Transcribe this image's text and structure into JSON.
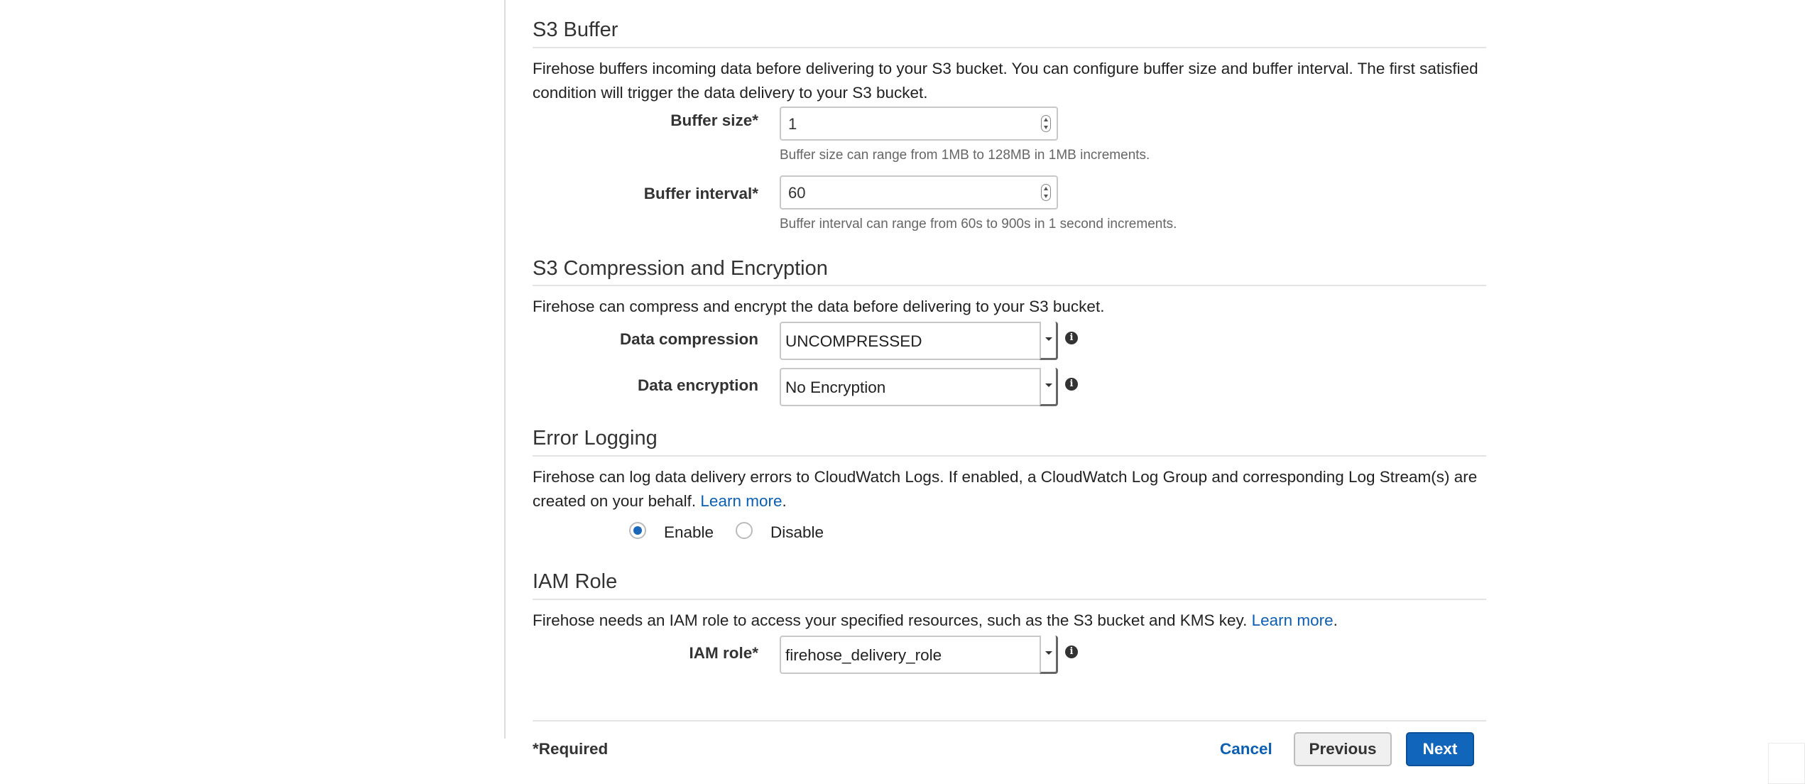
{
  "s3_buffer": {
    "title": "S3 Buffer",
    "description": "Firehose buffers incoming data before delivering to your S3 bucket. You can configure buffer size and buffer interval. The first satisfied condition will trigger the data delivery to your S3 bucket.",
    "buffer_size_label": "Buffer size*",
    "buffer_size_value": "1",
    "buffer_size_help": "Buffer size can range from 1MB to 128MB in 1MB increments.",
    "buffer_interval_label": "Buffer interval*",
    "buffer_interval_value": "60",
    "buffer_interval_help": "Buffer interval can range from 60s to 900s in 1 second increments."
  },
  "compression": {
    "title": "S3 Compression and Encryption",
    "description": "Firehose can compress and encrypt the data before delivering to your S3 bucket.",
    "compression_label": "Data compression",
    "compression_value": "UNCOMPRESSED",
    "encryption_label": "Data encryption",
    "encryption_value": "No Encryption"
  },
  "error_logging": {
    "title": "Error Logging",
    "description": "Firehose can log data delivery errors to CloudWatch Logs. If enabled, a CloudWatch Log Group and corresponding Log Stream(s) are created on your behalf.",
    "learn_more": "Learn more",
    "enable_label": "Enable",
    "disable_label": "Disable",
    "selected": "Enable"
  },
  "iam": {
    "title": "IAM Role",
    "description": "Firehose needs an IAM role to access your specified resources, such as the S3 bucket and KMS key.",
    "learn_more": "Learn more",
    "role_label": "IAM role*",
    "role_value": "firehose_delivery_role"
  },
  "footer": {
    "required_note": "*Required",
    "cancel_label": "Cancel",
    "previous_label": "Previous",
    "next_label": "Next"
  },
  "colors": {
    "link": "#0b5fb3",
    "primary_button": "#1166bb",
    "radio_selected": "#1a66b8"
  },
  "icons": {
    "info": "info-icon",
    "dropdown": "chevron-down-icon",
    "spinner": "spinner-icon"
  }
}
